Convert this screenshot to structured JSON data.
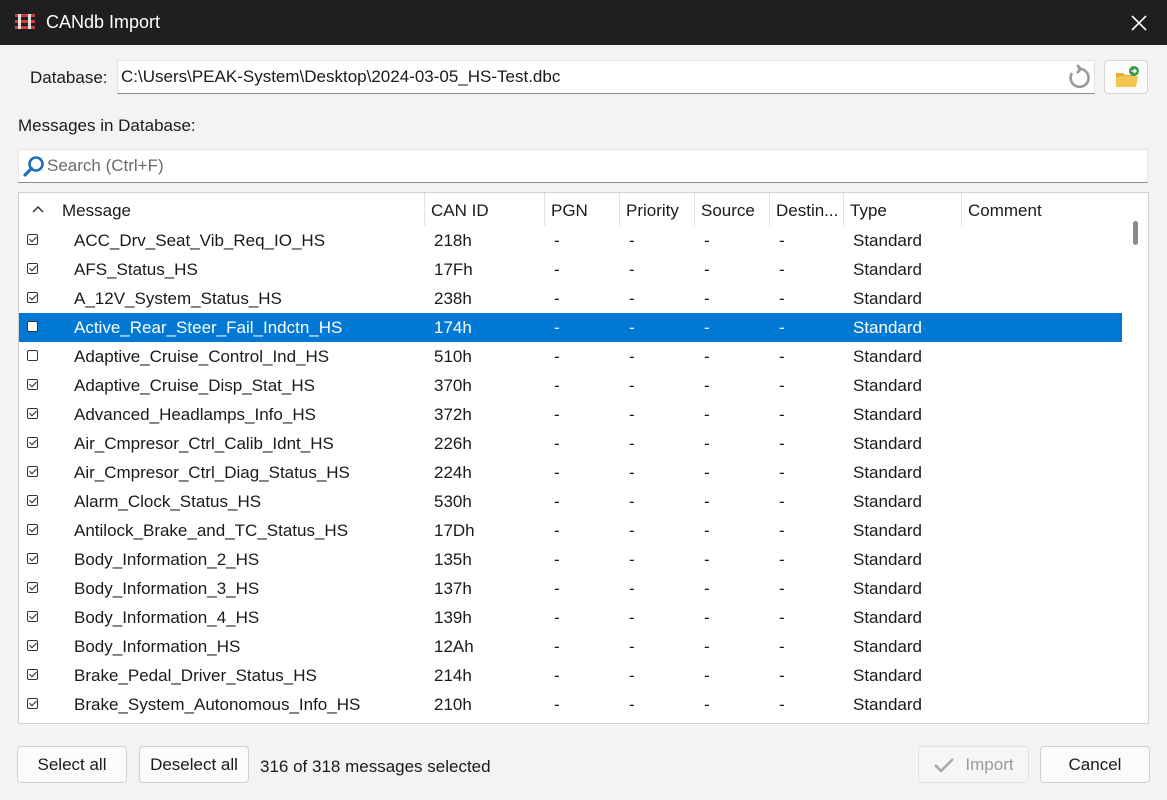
{
  "window": {
    "title": "CANdb Import"
  },
  "database": {
    "label": "Database:",
    "path": "C:\\Users\\PEAK-System\\Desktop\\2024-03-05_HS-Test.dbc"
  },
  "messages_label": "Messages in Database:",
  "search": {
    "placeholder": "Search (Ctrl+F)",
    "value": ""
  },
  "table": {
    "columns": [
      "Message",
      "CAN ID",
      "PGN",
      "Priority",
      "Source",
      "Destin...",
      "Type",
      "Comment"
    ],
    "sort": "ascending",
    "rows": [
      {
        "checked": true,
        "selected": false,
        "message": "ACC_Drv_Seat_Vib_Req_IO_HS",
        "can_id": "218h",
        "pgn": "-",
        "priority": "-",
        "source": "-",
        "destination": "-",
        "type": "Standard",
        "comment": ""
      },
      {
        "checked": true,
        "selected": false,
        "message": "AFS_Status_HS",
        "can_id": "17Fh",
        "pgn": "-",
        "priority": "-",
        "source": "-",
        "destination": "-",
        "type": "Standard",
        "comment": ""
      },
      {
        "checked": true,
        "selected": false,
        "message": "A_12V_System_Status_HS",
        "can_id": "238h",
        "pgn": "-",
        "priority": "-",
        "source": "-",
        "destination": "-",
        "type": "Standard",
        "comment": ""
      },
      {
        "checked": false,
        "selected": true,
        "message": "Active_Rear_Steer_Fail_Indctn_HS",
        "can_id": "174h",
        "pgn": "-",
        "priority": "-",
        "source": "-",
        "destination": "-",
        "type": "Standard",
        "comment": ""
      },
      {
        "checked": false,
        "selected": false,
        "message": "Adaptive_Cruise_Control_Ind_HS",
        "can_id": "510h",
        "pgn": "-",
        "priority": "-",
        "source": "-",
        "destination": "-",
        "type": "Standard",
        "comment": ""
      },
      {
        "checked": true,
        "selected": false,
        "message": "Adaptive_Cruise_Disp_Stat_HS",
        "can_id": "370h",
        "pgn": "-",
        "priority": "-",
        "source": "-",
        "destination": "-",
        "type": "Standard",
        "comment": ""
      },
      {
        "checked": true,
        "selected": false,
        "message": "Advanced_Headlamps_Info_HS",
        "can_id": "372h",
        "pgn": "-",
        "priority": "-",
        "source": "-",
        "destination": "-",
        "type": "Standard",
        "comment": ""
      },
      {
        "checked": true,
        "selected": false,
        "message": "Air_Cmpresor_Ctrl_Calib_Idnt_HS",
        "can_id": "226h",
        "pgn": "-",
        "priority": "-",
        "source": "-",
        "destination": "-",
        "type": "Standard",
        "comment": ""
      },
      {
        "checked": true,
        "selected": false,
        "message": "Air_Cmpresor_Ctrl_Diag_Status_HS",
        "can_id": "224h",
        "pgn": "-",
        "priority": "-",
        "source": "-",
        "destination": "-",
        "type": "Standard",
        "comment": ""
      },
      {
        "checked": true,
        "selected": false,
        "message": "Alarm_Clock_Status_HS",
        "can_id": "530h",
        "pgn": "-",
        "priority": "-",
        "source": "-",
        "destination": "-",
        "type": "Standard",
        "comment": ""
      },
      {
        "checked": true,
        "selected": false,
        "message": "Antilock_Brake_and_TC_Status_HS",
        "can_id": "17Dh",
        "pgn": "-",
        "priority": "-",
        "source": "-",
        "destination": "-",
        "type": "Standard",
        "comment": ""
      },
      {
        "checked": true,
        "selected": false,
        "message": "Body_Information_2_HS",
        "can_id": "135h",
        "pgn": "-",
        "priority": "-",
        "source": "-",
        "destination": "-",
        "type": "Standard",
        "comment": ""
      },
      {
        "checked": true,
        "selected": false,
        "message": "Body_Information_3_HS",
        "can_id": "137h",
        "pgn": "-",
        "priority": "-",
        "source": "-",
        "destination": "-",
        "type": "Standard",
        "comment": ""
      },
      {
        "checked": true,
        "selected": false,
        "message": "Body_Information_4_HS",
        "can_id": "139h",
        "pgn": "-",
        "priority": "-",
        "source": "-",
        "destination": "-",
        "type": "Standard",
        "comment": ""
      },
      {
        "checked": true,
        "selected": false,
        "message": "Body_Information_HS",
        "can_id": "12Ah",
        "pgn": "-",
        "priority": "-",
        "source": "-",
        "destination": "-",
        "type": "Standard",
        "comment": ""
      },
      {
        "checked": true,
        "selected": false,
        "message": "Brake_Pedal_Driver_Status_HS",
        "can_id": "214h",
        "pgn": "-",
        "priority": "-",
        "source": "-",
        "destination": "-",
        "type": "Standard",
        "comment": ""
      },
      {
        "checked": true,
        "selected": false,
        "message": "Brake_System_Autonomous_Info_HS",
        "can_id": "210h",
        "pgn": "-",
        "priority": "-",
        "source": "-",
        "destination": "-",
        "type": "Standard",
        "comment": ""
      }
    ]
  },
  "footer": {
    "select_all": "Select all",
    "deselect_all": "Deselect all",
    "status": "316 of 318 messages selected",
    "import": "Import",
    "cancel": "Cancel"
  },
  "colors": {
    "titlebar": "#1f1f1f",
    "selection": "#0078d4",
    "accent_icon": "#1e6fb8"
  },
  "icons": {
    "app": "candb-app-icon",
    "close": "close-icon",
    "reload": "reload-icon",
    "folder": "open-folder-icon",
    "search": "search-icon",
    "sort": "sort-ascending-icon",
    "import": "check-icon"
  }
}
